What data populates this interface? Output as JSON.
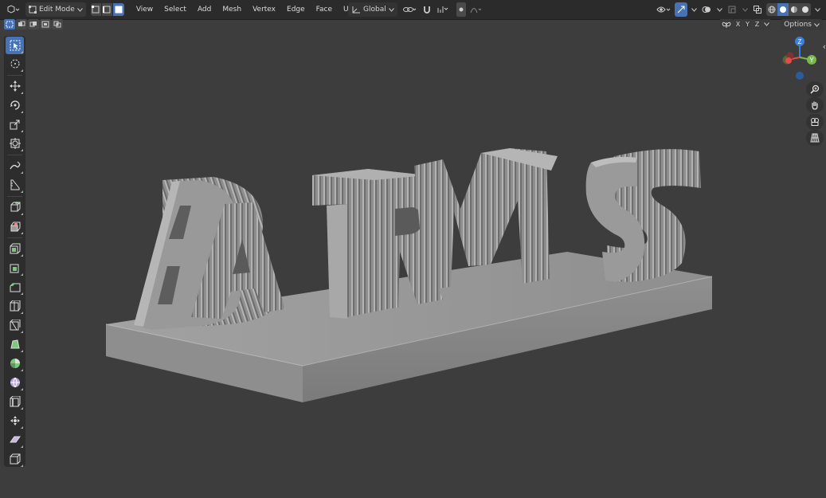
{
  "header": {
    "editor_type_icon": "cube-editor-icon",
    "mode": {
      "label": "Edit Mode",
      "icon": "edit-mode-icon"
    },
    "select_mode_icons": [
      "vertex-select-icon",
      "edge-select-icon",
      "face-select-icon"
    ],
    "menus": [
      "View",
      "Select",
      "Add",
      "Mesh",
      "Vertex",
      "Edge",
      "Face",
      "UV"
    ],
    "transform_orientation": "Global"
  },
  "subheader": {
    "mirror_axes": [
      "X",
      "Y",
      "Z"
    ],
    "options_label": "Options"
  },
  "gizmo": {
    "z_label": "Z",
    "y_label": "Y"
  },
  "colors": {
    "accent": "#4772b3",
    "viewport_bg": "#3d3d3d",
    "header_bg": "#2b2b2b",
    "axis_x": "#e34a4a",
    "axis_y": "#7ab84f",
    "axis_z": "#3d7fd9"
  },
  "scene": {
    "letters": [
      "B",
      "A",
      "T",
      "R",
      "M",
      "S"
    ]
  }
}
